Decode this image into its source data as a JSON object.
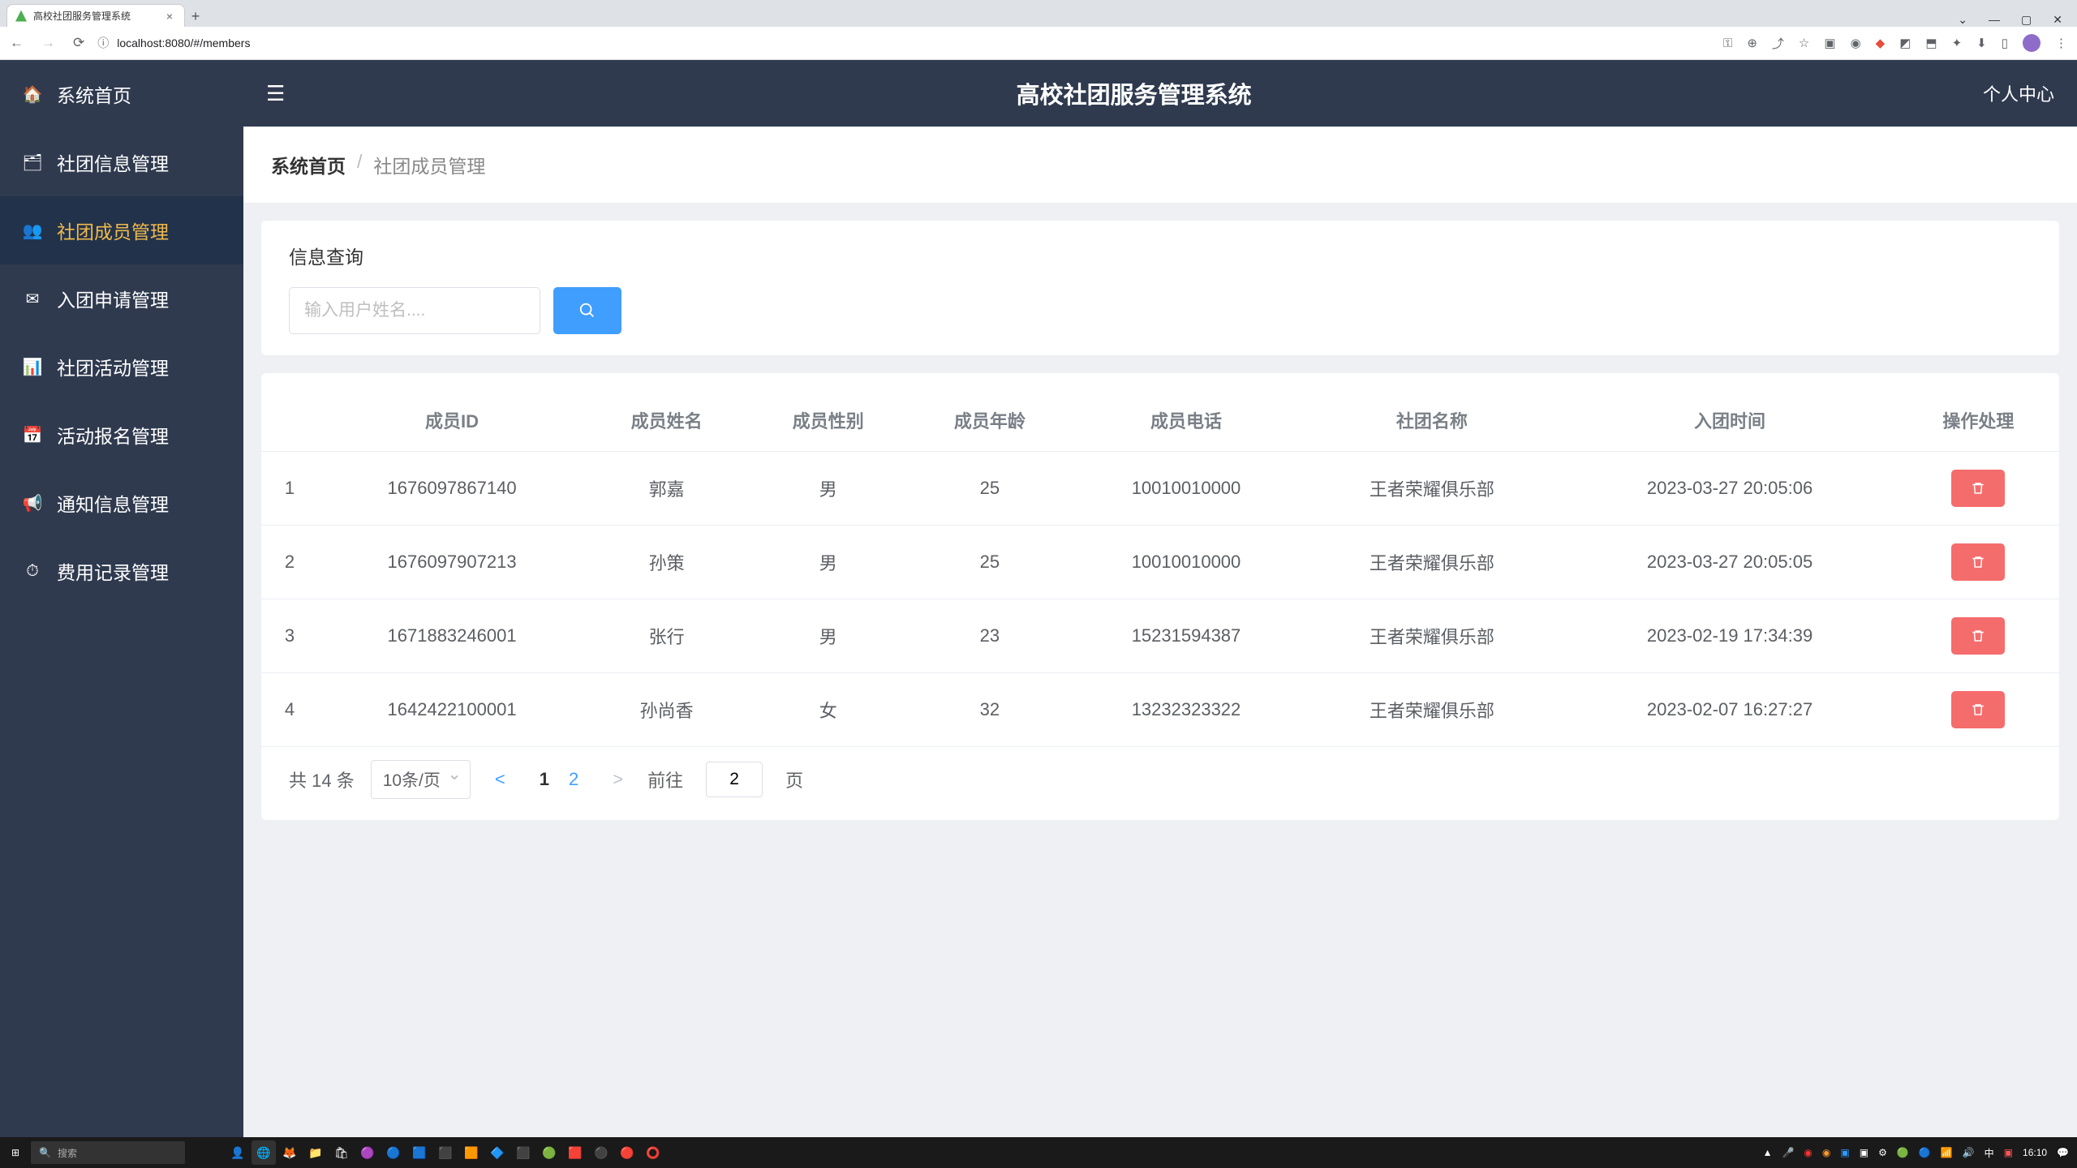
{
  "browser": {
    "tab_title": "高校社团服务管理系统",
    "url": "localhost:8080/#/members"
  },
  "app": {
    "title": "高校社团服务管理系统",
    "user_center": "个人中心"
  },
  "sidebar": {
    "items": [
      {
        "label": "系统首页",
        "icon": "🏠"
      },
      {
        "label": "社团信息管理",
        "icon": "🗂"
      },
      {
        "label": "社团成员管理",
        "icon": "👥",
        "active": true
      },
      {
        "label": "入团申请管理",
        "icon": "✉"
      },
      {
        "label": "社团活动管理",
        "icon": "📊"
      },
      {
        "label": "活动报名管理",
        "icon": "📅"
      },
      {
        "label": "通知信息管理",
        "icon": "📢"
      },
      {
        "label": "费用记录管理",
        "icon": "⏱"
      }
    ]
  },
  "breadcrumb": {
    "home": "系统首页",
    "current": "社团成员管理"
  },
  "search": {
    "panel_title": "信息查询",
    "placeholder": "输入用户姓名...."
  },
  "table": {
    "headers": [
      "",
      "成员ID",
      "成员姓名",
      "成员性别",
      "成员年龄",
      "成员电话",
      "社团名称",
      "入团时间",
      "操作处理"
    ],
    "rows": [
      {
        "idx": "1",
        "id": "1676097867140",
        "name": "郭嘉",
        "gender": "男",
        "age": "25",
        "phone": "10010010000",
        "club": "王者荣耀俱乐部",
        "join": "2023-03-27 20:05:06"
      },
      {
        "idx": "2",
        "id": "1676097907213",
        "name": "孙策",
        "gender": "男",
        "age": "25",
        "phone": "10010010000",
        "club": "王者荣耀俱乐部",
        "join": "2023-03-27 20:05:05"
      },
      {
        "idx": "3",
        "id": "1671883246001",
        "name": "张行",
        "gender": "男",
        "age": "23",
        "phone": "15231594387",
        "club": "王者荣耀俱乐部",
        "join": "2023-02-19 17:34:39"
      },
      {
        "idx": "4",
        "id": "1642422100001",
        "name": "孙尚香",
        "gender": "女",
        "age": "32",
        "phone": "13232323322",
        "club": "王者荣耀俱乐部",
        "join": "2023-02-07 16:27:27"
      }
    ]
  },
  "pagination": {
    "total": "共 14 条",
    "page_size": "10条/页",
    "pages": [
      "1",
      "2"
    ],
    "current": "1",
    "goto_label": "前往",
    "goto_value": "2",
    "page_suffix": "页"
  },
  "taskbar": {
    "search": "搜索",
    "time": "16:10"
  }
}
